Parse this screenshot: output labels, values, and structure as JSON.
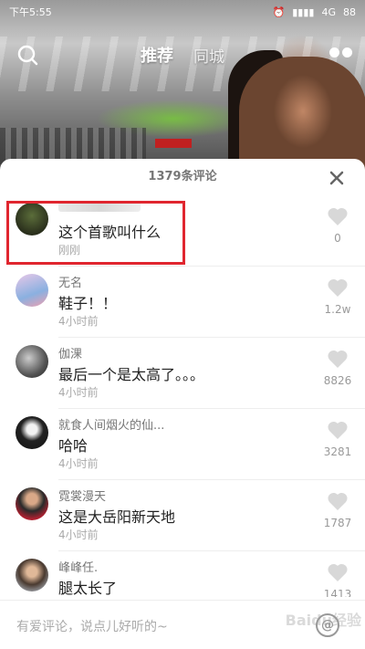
{
  "status_bar": {
    "time": "下午5:55",
    "network": "4G",
    "battery": "88"
  },
  "nav": {
    "tabs": [
      "推荐",
      "同城"
    ]
  },
  "panel": {
    "comment_count_label": "1379条评论"
  },
  "comments": [
    {
      "name": "",
      "text": "这个首歌叫什么",
      "time": "刚刚",
      "likes": "0"
    },
    {
      "name": "无名",
      "text": "鞋子！！",
      "time": "4小时前",
      "likes": "1.2w"
    },
    {
      "name": "伽淉",
      "text": "最后一个是太高了。。。",
      "time": "4小时前",
      "likes": "8826"
    },
    {
      "name": "就食人间烟火的仙...",
      "text": "哈哈",
      "time": "4小时前",
      "likes": "3281"
    },
    {
      "name": "霓裳漫天",
      "text": "这是大岳阳新天地",
      "time": "4小时前",
      "likes": "1787"
    },
    {
      "name": "峰峰任.",
      "text": "腿太长了",
      "time": "",
      "likes": "1413"
    }
  ],
  "input": {
    "placeholder": "有爱评论，说点儿好听的~",
    "at_symbol": "@"
  },
  "watermark": "Baidu经验",
  "colors": {
    "highlight": "#e0262f",
    "panel_bg": "#ffffff",
    "like_icon": "#d8d8d8"
  }
}
